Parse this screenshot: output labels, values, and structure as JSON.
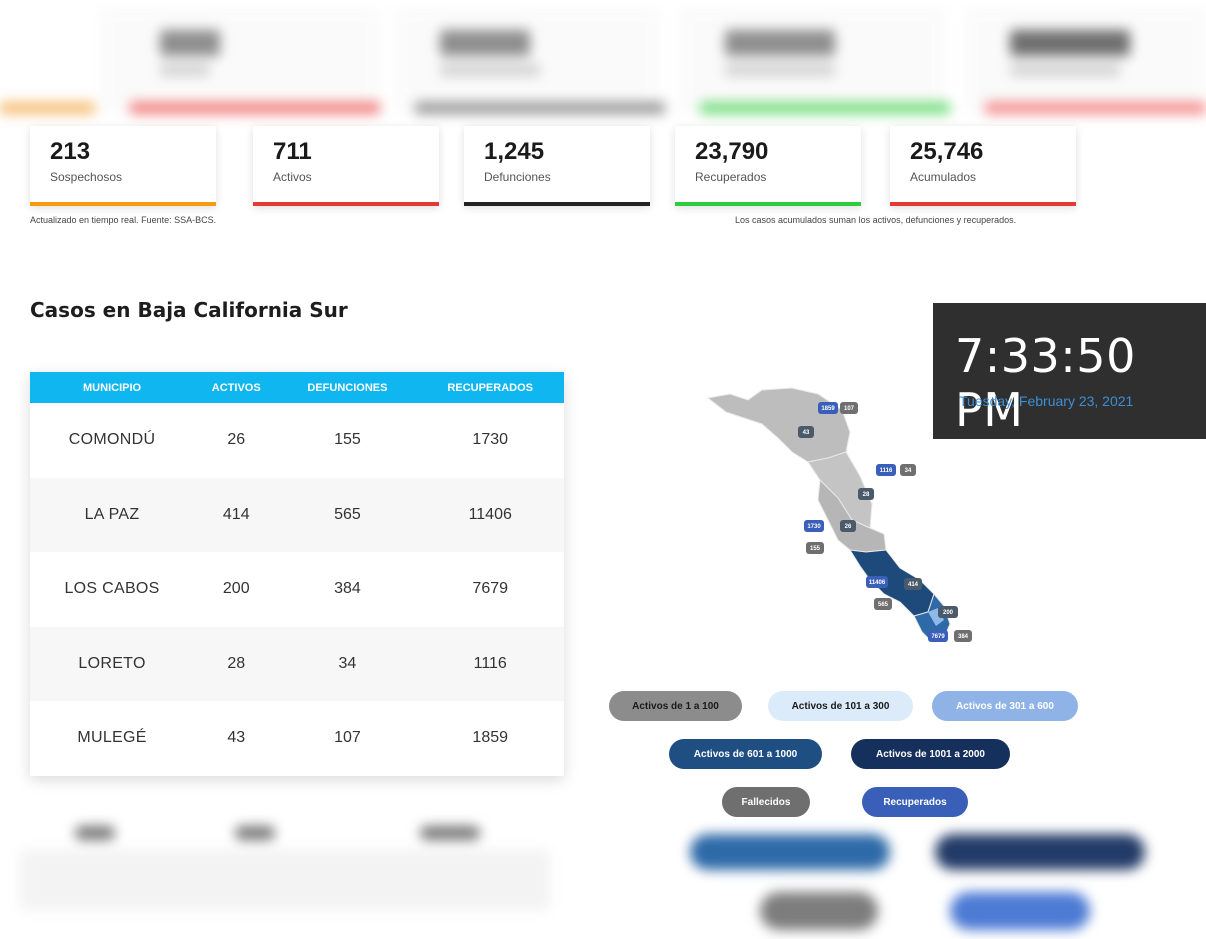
{
  "stats": [
    {
      "value": "213",
      "label": "Sospechosos",
      "color": "#f39c12"
    },
    {
      "value": "711",
      "label": "Activos",
      "color": "#e53935"
    },
    {
      "value": "1,245",
      "label": "Defunciones",
      "color": "#222222"
    },
    {
      "value": "23,790",
      "label": "Recuperados",
      "color": "#2ecc40"
    },
    {
      "value": "25,746",
      "label": "Acumulados",
      "color": "#e53935"
    }
  ],
  "notes": {
    "left": "Actualizado en tiempo real. Fuente: SSA-BCS.",
    "right": "Los casos acumulados suman los activos, defunciones y recuperados."
  },
  "section_title": "Casos en Baja California Sur",
  "table": {
    "headers": [
      "MUNICIPIO",
      "ACTIVOS",
      "DEFUNCIONES",
      "RECUPERADOS"
    ],
    "rows": [
      [
        "COMONDÚ",
        "26",
        "155",
        "1730"
      ],
      [
        "LA PAZ",
        "414",
        "565",
        "11406"
      ],
      [
        "LOS CABOS",
        "200",
        "384",
        "7679"
      ],
      [
        "LORETO",
        "28",
        "34",
        "1116"
      ],
      [
        "MULEGÉ",
        "43",
        "107",
        "1859"
      ]
    ]
  },
  "clock": {
    "time": "7:33:50 PM",
    "date": "Tuesday, February 23, 2021"
  },
  "map_tags": {
    "mulege_recuperados": "1859",
    "mulege_defunciones": "107",
    "mulege_activos": "43",
    "loreto_recuperados": "1116",
    "loreto_defunciones": "34",
    "loreto_activos": "28",
    "comondu_recuperados": "1730",
    "comondu_activos": "26",
    "comondu_defunciones": "155",
    "lapaz_recuperados": "11406",
    "lapaz_activos": "414",
    "lapaz_defunciones": "565",
    "loscabos_activos": "200",
    "loscabos_recuperados": "7679",
    "loscabos_defunciones": "384"
  },
  "legend": [
    {
      "label": "Activos de 1 a 100",
      "bg": "#8c8c8c",
      "fg": "#1a1a1a"
    },
    {
      "label": "Activos de 101 a 300",
      "bg": "#dcebfa",
      "fg": "#1a1a1a"
    },
    {
      "label": "Activos de 301 a 600",
      "bg": "#8fb3e6",
      "fg": "#ffffff"
    },
    {
      "label": "Activos de 601 a 1000",
      "bg": "#1f4f82",
      "fg": "#ffffff"
    },
    {
      "label": "Activos de 1001 a 2000",
      "bg": "#15305c",
      "fg": "#ffffff"
    },
    {
      "label": "Fallecidos",
      "bg": "#6f6f6f",
      "fg": "#ffffff"
    },
    {
      "label": "Recuperados",
      "bg": "#3a5fb8",
      "fg": "#ffffff"
    }
  ],
  "colors": {
    "header_bg": "#0fb6f0",
    "clock_bg": "#2f2f2f",
    "clock_date": "#3c8fd6",
    "map_gray": "#bdbdbd",
    "map_dark_blue": "#1d4a7a",
    "map_mid_blue": "#2e6aa8",
    "map_light_blue": "#8fb8e8"
  }
}
